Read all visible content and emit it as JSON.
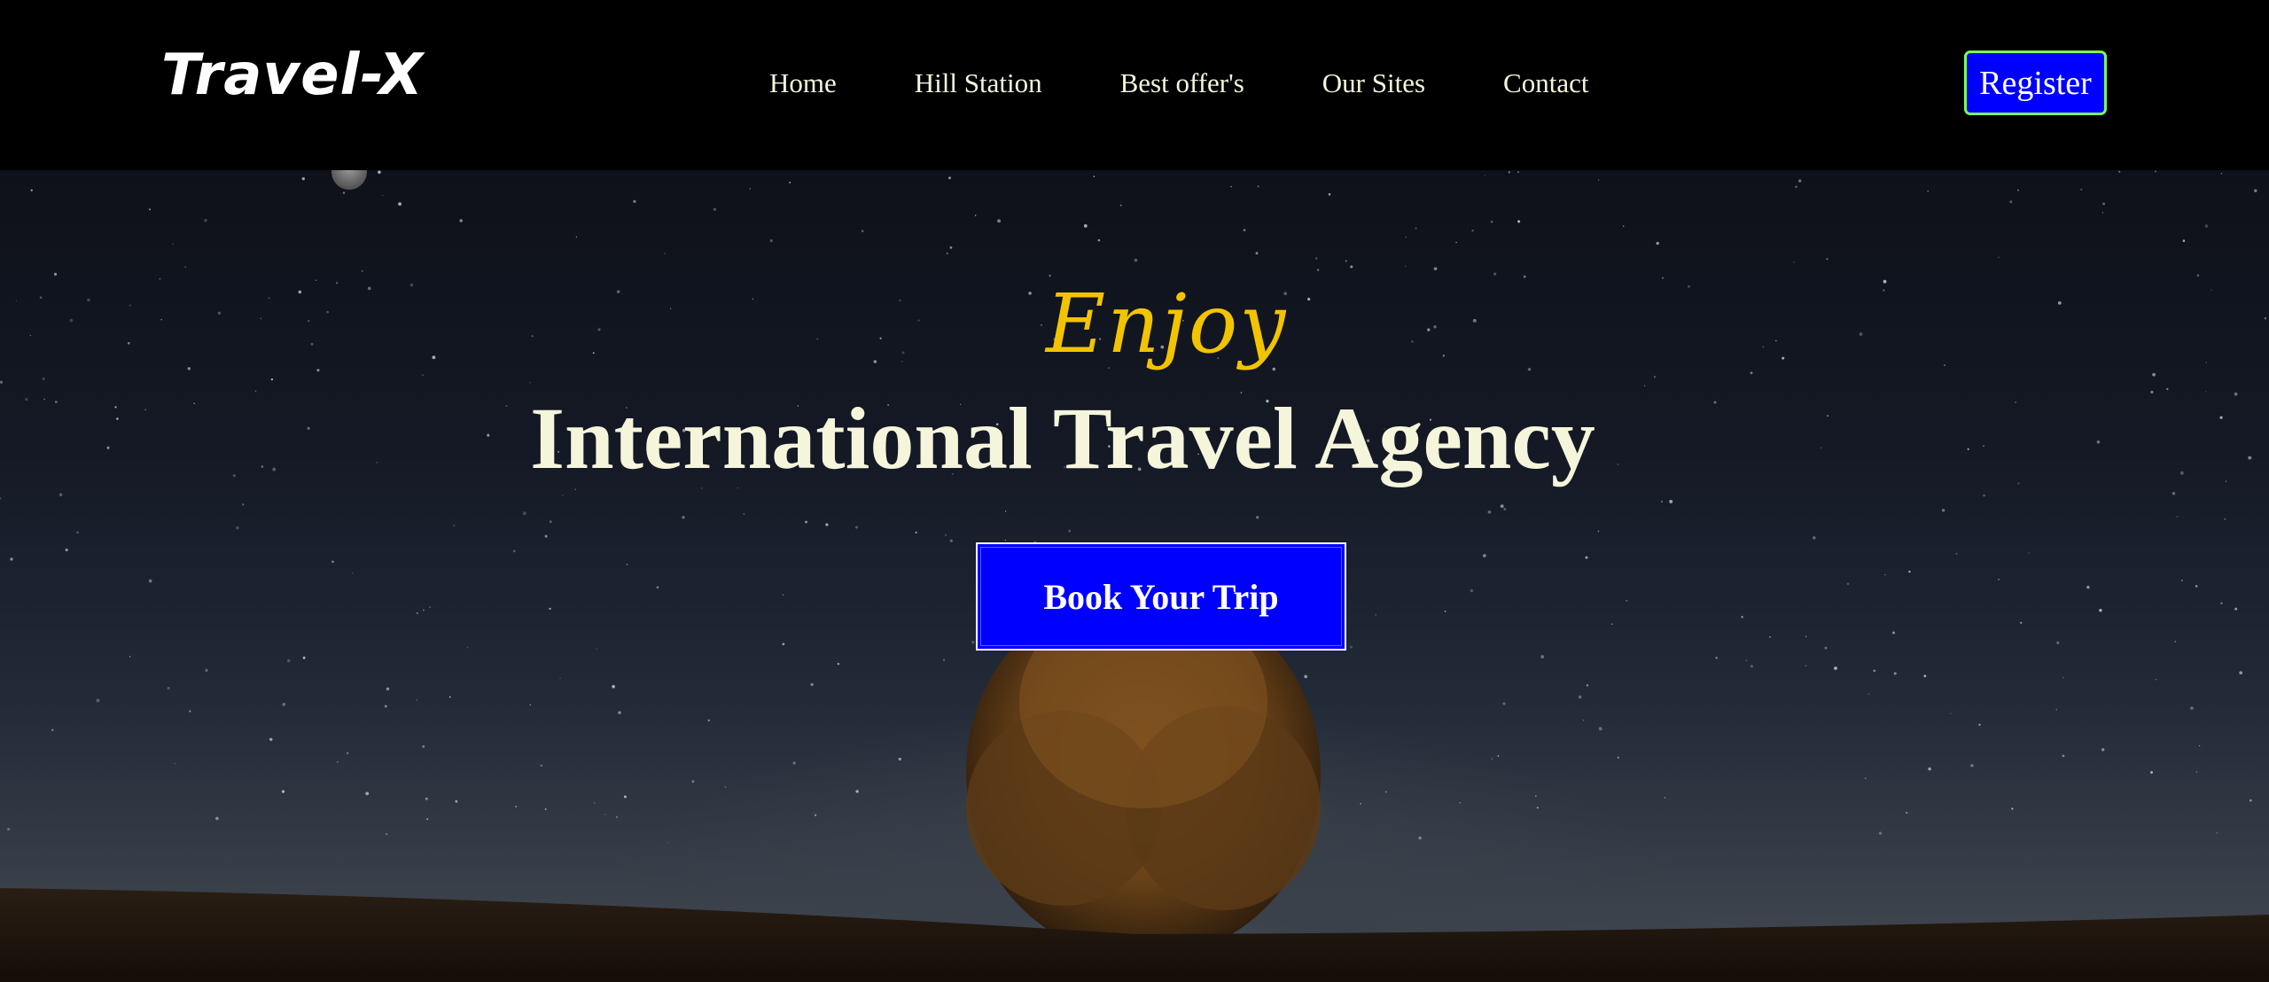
{
  "nav": {
    "logo": "Travel-X",
    "links": [
      "Home",
      "Hill Station",
      "Best offer's",
      "Our Sites",
      "Contact"
    ],
    "register_label": "Register"
  },
  "hero": {
    "kicker": "Enjoy",
    "headline": "International Travel Agency",
    "cta_label": "Book Your Trip"
  },
  "colors": {
    "nav_bg": "#000000",
    "nav_text": "#f5f5dc",
    "register_bg": "#0000ff",
    "register_border": "#7cfc5a",
    "kicker": "#f2c400",
    "headline": "#f5f5dc",
    "cta_bg": "#0000ff"
  }
}
